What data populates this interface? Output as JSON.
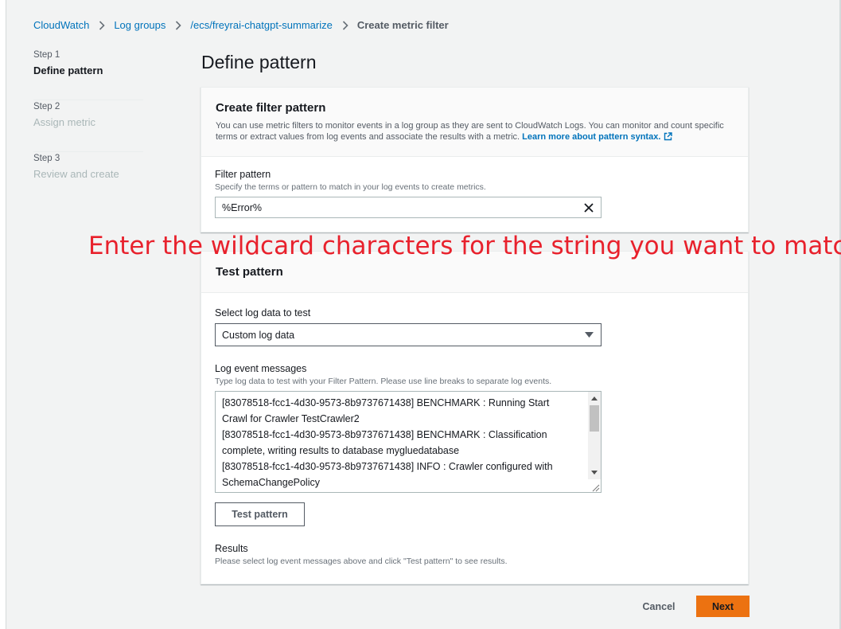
{
  "breadcrumb": [
    {
      "label": "CloudWatch"
    },
    {
      "label": "Log groups"
    },
    {
      "label": "/ecs/freyrai-chatgpt-summarize"
    },
    {
      "label": "Create metric filter"
    }
  ],
  "steps": [
    {
      "step_label": "Step 1",
      "name": "Define pattern",
      "state": "active"
    },
    {
      "step_label": "Step 2",
      "name": "Assign metric",
      "state": "disabled"
    },
    {
      "step_label": "Step 3",
      "name": "Review and create",
      "state": "disabled"
    }
  ],
  "page": {
    "title": "Define pattern"
  },
  "filter_section": {
    "title": "Create filter pattern",
    "description": "You can use metric filters to monitor events in a log group as they are sent to CloudWatch Logs. You can monitor and count specific terms or extract values from log events and associate the results with a metric.",
    "learn_more_link": "Learn more about pattern syntax.",
    "field_label": "Filter pattern",
    "field_hint": "Specify the terms or pattern to match in your log events to create metrics.",
    "field_value": "%Error%"
  },
  "annotation": {
    "text": "Enter the wildcard characters for the string you want to match."
  },
  "test_section": {
    "title": "Test pattern",
    "select_label": "Select log data to test",
    "select_value": "Custom log data",
    "messages_label": "Log event messages",
    "messages_hint": "Type log data to test with your Filter Pattern. Please use line breaks to separate log events.",
    "message_lines": [
      "[83078518-fcc1-4d30-9573-8b9737671438] BENCHMARK : Running Start",
      "Crawl for Crawler TestCrawler2",
      "[83078518-fcc1-4d30-9573-8b9737671438] BENCHMARK : Classification",
      "complete, writing results to database mygluedatabase",
      "[83078518-fcc1-4d30-9573-8b9737671438] INFO : Crawler configured with",
      "SchemaChangePolicy"
    ],
    "test_button": "Test pattern",
    "results_label": "Results",
    "results_text": "Please select log event messages above and click \"Test pattern\" to see results."
  },
  "footer": {
    "cancel_label": "Cancel",
    "next_label": "Next"
  },
  "colors": {
    "link": "#0073bb",
    "primary_button": "#ec7211",
    "annotation": "#e8212c",
    "page_background": "#f2f3f3"
  }
}
